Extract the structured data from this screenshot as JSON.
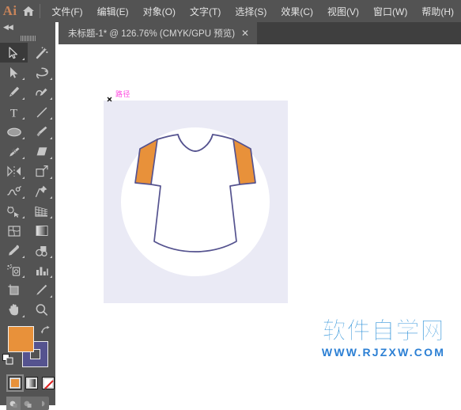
{
  "app": {
    "logo_text": "Ai",
    "logo_color": "#c9845a",
    "home_icon": "home-icon"
  },
  "menubar": {
    "items": [
      {
        "label": "文件(F)",
        "name": "menu-file"
      },
      {
        "label": "编辑(E)",
        "name": "menu-edit"
      },
      {
        "label": "对象(O)",
        "name": "menu-object"
      },
      {
        "label": "文字(T)",
        "name": "menu-type"
      },
      {
        "label": "选择(S)",
        "name": "menu-select"
      },
      {
        "label": "效果(C)",
        "name": "menu-effect"
      },
      {
        "label": "视图(V)",
        "name": "menu-view"
      },
      {
        "label": "窗口(W)",
        "name": "menu-window"
      },
      {
        "label": "帮助(H)",
        "name": "menu-help"
      }
    ],
    "background": "#535353"
  },
  "document_tab": {
    "title": "未标题-1* @ 126.76% (CMYK/GPU 预览)",
    "close_label": "✕",
    "zoom_level": "126.76%",
    "color_mode": "CMYK/GPU 预览",
    "modified": true
  },
  "toolbar": {
    "collapse_label": "◀◀",
    "active_tool": "selection-tool",
    "tools": [
      {
        "name": "selection-tool",
        "icon": "arrow-solid-outline-icon",
        "active": true,
        "has_flyout": true
      },
      {
        "name": "magic-wand-tool",
        "icon": "magic-wand-icon",
        "active": false,
        "has_flyout": false
      },
      {
        "name": "direct-selection-tool",
        "icon": "arrow-filled-icon",
        "active": false,
        "has_flyout": true
      },
      {
        "name": "lasso-tool",
        "icon": "lasso-icon",
        "active": false,
        "has_flyout": true
      },
      {
        "name": "pen-tool",
        "icon": "pen-icon",
        "active": false,
        "has_flyout": true
      },
      {
        "name": "curvature-tool",
        "icon": "curvature-pen-icon",
        "active": false,
        "has_flyout": true
      },
      {
        "name": "type-tool",
        "icon": "type-t-icon",
        "active": false,
        "has_flyout": true
      },
      {
        "name": "line-segment-tool",
        "icon": "line-diagonal-icon",
        "active": false,
        "has_flyout": true
      },
      {
        "name": "ellipse-tool",
        "icon": "ellipse-icon",
        "active": false,
        "has_flyout": true
      },
      {
        "name": "paintbrush-tool",
        "icon": "paintbrush-icon",
        "active": false,
        "has_flyout": true
      },
      {
        "name": "shaper-tool",
        "icon": "pencil-shaper-icon",
        "active": false,
        "has_flyout": true
      },
      {
        "name": "eraser-tool",
        "icon": "eraser-icon",
        "active": false,
        "has_flyout": true
      },
      {
        "name": "rotate-tool",
        "icon": "reflect-rotate-icon",
        "active": false,
        "has_flyout": true
      },
      {
        "name": "scale-tool",
        "icon": "scale-transform-icon",
        "active": false,
        "has_flyout": true
      },
      {
        "name": "width-tool",
        "icon": "warp-width-icon",
        "active": false,
        "has_flyout": true
      },
      {
        "name": "free-transform-tool",
        "icon": "pushpin-icon",
        "active": false,
        "has_flyout": true
      },
      {
        "name": "shape-builder-tool",
        "icon": "shape-builder-icon",
        "active": false,
        "has_flyout": true
      },
      {
        "name": "perspective-grid-tool",
        "icon": "perspective-grid-icon",
        "active": false,
        "has_flyout": true
      },
      {
        "name": "mesh-tool",
        "icon": "mesh-icon",
        "active": false,
        "has_flyout": false
      },
      {
        "name": "gradient-tool",
        "icon": "gradient-icon",
        "active": false,
        "has_flyout": false
      },
      {
        "name": "eyedropper-tool",
        "icon": "eyedropper-icon",
        "active": false,
        "has_flyout": true
      },
      {
        "name": "blend-tool",
        "icon": "blend-circles-icon",
        "active": false,
        "has_flyout": true
      },
      {
        "name": "symbol-sprayer-tool",
        "icon": "symbol-sprayer-icon",
        "active": false,
        "has_flyout": true
      },
      {
        "name": "column-graph-tool",
        "icon": "bar-chart-icon",
        "active": false,
        "has_flyout": true
      },
      {
        "name": "artboard-tool",
        "icon": "artboard-icon",
        "active": false,
        "has_flyout": false
      },
      {
        "name": "slice-tool",
        "icon": "knife-slice-icon",
        "active": false,
        "has_flyout": true
      },
      {
        "name": "hand-tool",
        "icon": "hand-icon",
        "active": false,
        "has_flyout": true
      },
      {
        "name": "zoom-tool",
        "icon": "magnifier-icon",
        "active": false,
        "has_flyout": false
      }
    ],
    "color": {
      "fill_color": "#e8913a",
      "stroke_color": "#55538f",
      "swap_icon": "swap-arrow-icon",
      "default_colors_icon": "default-fill-stroke-icon"
    },
    "fill_modes": [
      {
        "name": "color-mode-button",
        "icon": "solid-color-icon",
        "selected": true
      },
      {
        "name": "gradient-mode-button",
        "icon": "gradient-swatch-icon",
        "selected": false
      },
      {
        "name": "none-mode-button",
        "icon": "none-slash-icon",
        "selected": false
      }
    ],
    "draw_modes": [
      {
        "name": "draw-normal-button",
        "icon": "draw-normal-icon",
        "selected": true
      },
      {
        "name": "draw-behind-button",
        "icon": "draw-behind-icon",
        "selected": false
      },
      {
        "name": "draw-inside-button",
        "icon": "draw-inside-icon",
        "selected": false
      }
    ]
  },
  "canvas": {
    "background": "#ffffff",
    "artboard_color": "#eaeaf5",
    "smart_guide_label": "路径",
    "smart_guide_color": "#ff49e1",
    "anchor_icon": "anchor-point-icon",
    "artwork": {
      "name": "t-shirt-illustration",
      "circle_color": "#ffffff",
      "shirt_body_color": "#ffffff",
      "sleeve_color": "#e8913a",
      "outline_color": "#55538f"
    }
  },
  "watermark": {
    "chinese": "软件自学网",
    "url": "WWW.RJZXW.COM",
    "color": "#1f8ad6"
  }
}
